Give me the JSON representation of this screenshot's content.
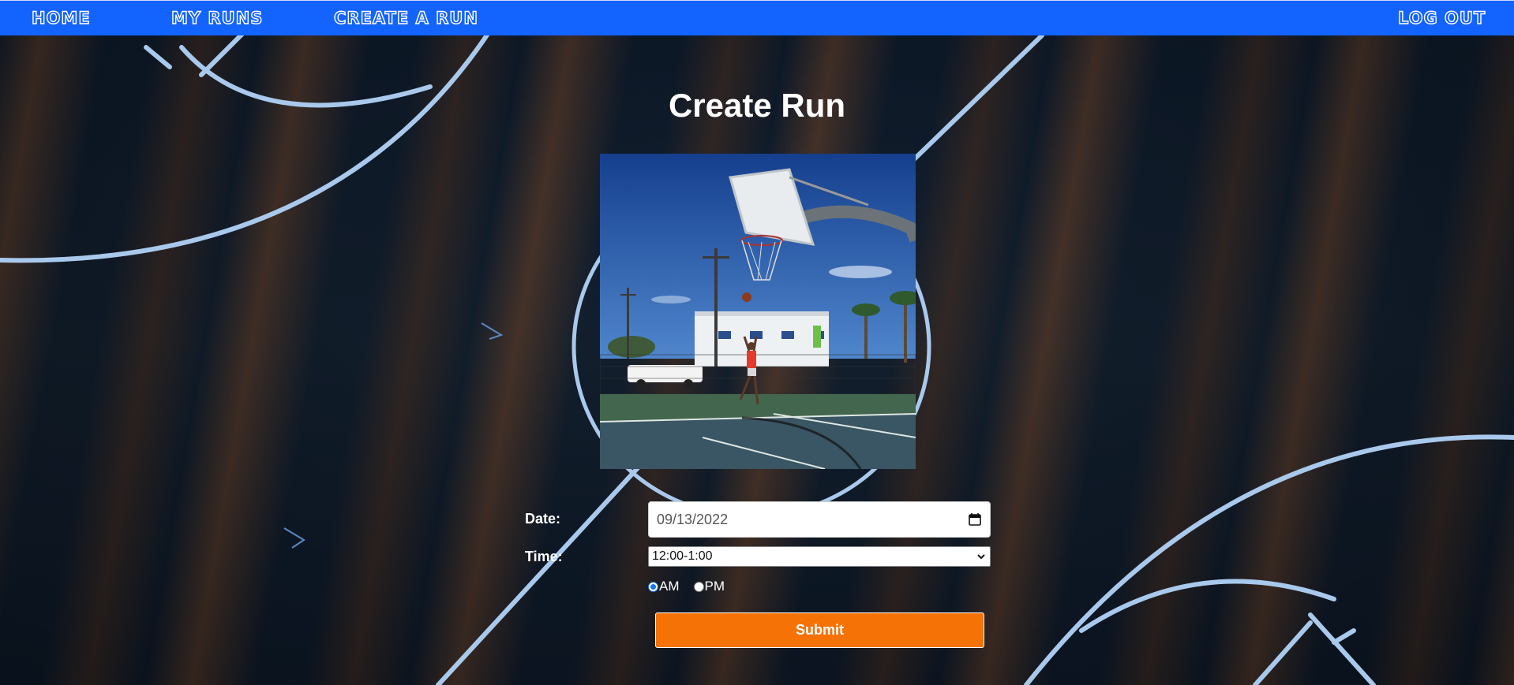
{
  "nav": {
    "home": "HOME",
    "my_runs": "MY RUNS",
    "create_run": "CREATE A RUN",
    "log_out": "LOG OUT"
  },
  "page": {
    "title": "Create Run"
  },
  "form": {
    "date_label": "Date:",
    "date_value": "09/13/2022",
    "time_label": "Time:",
    "time_value": "12:00-1:00",
    "am_label": "AM",
    "pm_label": "PM",
    "am_checked": true,
    "pm_checked": false,
    "submit_label": "Submit"
  },
  "colors": {
    "nav_bg": "#1363ff",
    "submit_bg": "#f47206",
    "court_line": "#a9c9ec"
  },
  "icons": {
    "date_picker": "calendar-icon",
    "select_toggle": "chevron-down-icon"
  }
}
